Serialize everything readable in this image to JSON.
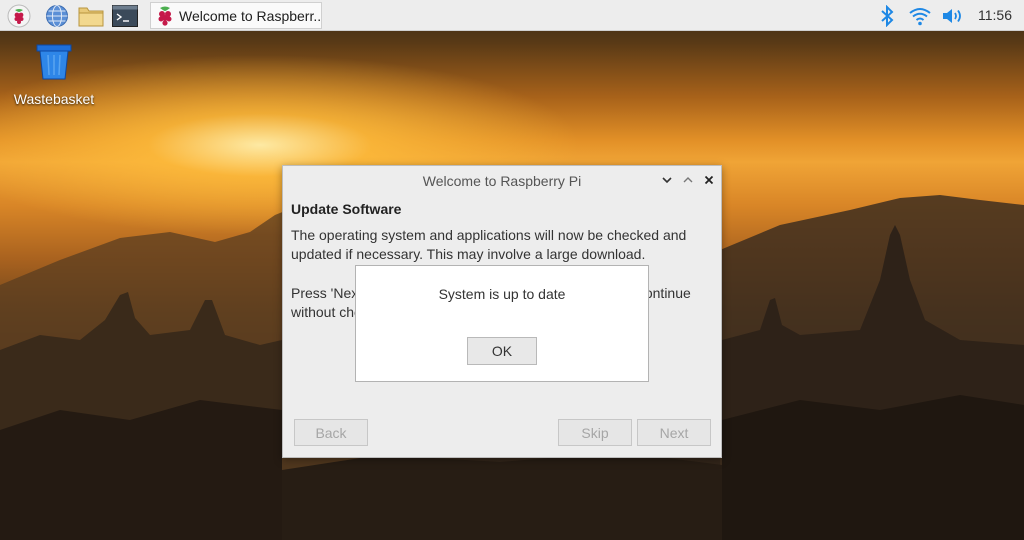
{
  "taskbar": {
    "launchers": [
      {
        "name": "raspberry-menu-icon"
      },
      {
        "name": "web-browser-icon"
      },
      {
        "name": "file-manager-icon"
      },
      {
        "name": "terminal-icon"
      }
    ],
    "task_window_label": "Welcome to Raspberr...",
    "tray": [
      "bluetooth-icon",
      "wifi-icon",
      "volume-icon"
    ],
    "clock": "11:56"
  },
  "desktop": {
    "icons": [
      {
        "label": "Wastebasket",
        "icon": "wastebasket-icon"
      }
    ]
  },
  "welcome_dialog": {
    "title": "Welcome to Raspberry Pi",
    "section_title": "Update Software",
    "description": "The operating system and applications will now be checked and updated if necessary. This may involve a large download.",
    "instruction": "Press 'Next' to check for and install updates, or 'Skip' to continue without checking.",
    "buttons": {
      "back": "Back",
      "skip": "Skip",
      "next": "Next"
    }
  },
  "popup": {
    "message": "System is up to date",
    "ok": "OK"
  },
  "colors": {
    "taskbar_bg": "#ededed",
    "dialog_bg": "#ededed",
    "raspberry_red": "#c51a4a",
    "raspberry_leaf": "#4caf50",
    "bluetooth_blue": "#1e88e5"
  }
}
